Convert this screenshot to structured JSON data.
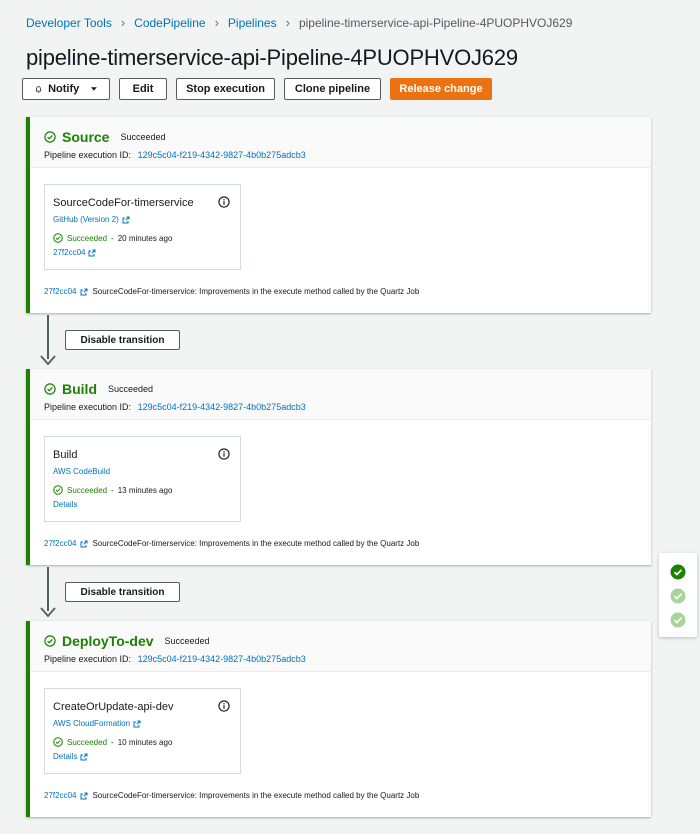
{
  "breadcrumb": {
    "items": [
      "Developer Tools",
      "CodePipeline",
      "Pipelines"
    ],
    "current": "pipeline-timerservice-api-Pipeline-4PUOPHVOJ629"
  },
  "page_title": "pipeline-timerservice-api-Pipeline-4PUOPHVOJ629",
  "toolbar": {
    "notify_label": "Notify",
    "edit_label": "Edit",
    "stop_label": "Stop execution",
    "clone_label": "Clone pipeline",
    "release_label": "Release change"
  },
  "colors": {
    "success": "#1d8102",
    "link": "#0073bb",
    "primary": "#ec7211"
  },
  "execution_id_label": "Pipeline execution ID:",
  "stages": [
    {
      "name": "Source",
      "status": "Succeeded",
      "execution_id": "129c5c04-f219-4342-9827-4b0b275adcb3",
      "action": {
        "name": "SourceCodeFor-timerservice",
        "provider": "GitHub (Version 2)",
        "status": "Succeeded",
        "time": "20 minutes ago",
        "link": "27f2cc04"
      },
      "commit": {
        "id": "27f2cc04",
        "message": "SourceCodeFor-timerservice: Improvements in the execute method called by the Quartz Job"
      }
    },
    {
      "name": "Build",
      "status": "Succeeded",
      "execution_id": "129c5c04-f219-4342-9827-4b0b275adcb3",
      "action": {
        "name": "Build",
        "provider": "AWS CodeBuild",
        "status": "Succeeded",
        "time": "13 minutes ago",
        "link": "Details"
      },
      "commit": {
        "id": "27f2cc04",
        "message": "SourceCodeFor-timerservice: Improvements in the execute method called by the Quartz Job"
      }
    },
    {
      "name": "DeployTo-dev",
      "status": "Succeeded",
      "execution_id": "129c5c04-f219-4342-9827-4b0b275adcb3",
      "action": {
        "name": "CreateOrUpdate-api-dev",
        "provider": "AWS CloudFormation",
        "status": "Succeeded",
        "time": "10 minutes ago",
        "link": "Details"
      },
      "commit": {
        "id": "27f2cc04",
        "message": "SourceCodeFor-timerservice: Improvements in the execute method called by the Quartz Job"
      }
    }
  ],
  "transitions": [
    {
      "label": "Disable transition"
    },
    {
      "label": "Disable transition"
    }
  ],
  "separator": "-",
  "icons": {
    "notify": "bell-icon",
    "dropdown": "caret-down-icon",
    "status": "check-circle-icon",
    "info": "info-icon",
    "external": "external-link-icon",
    "arrow": "arrow-down-icon"
  }
}
